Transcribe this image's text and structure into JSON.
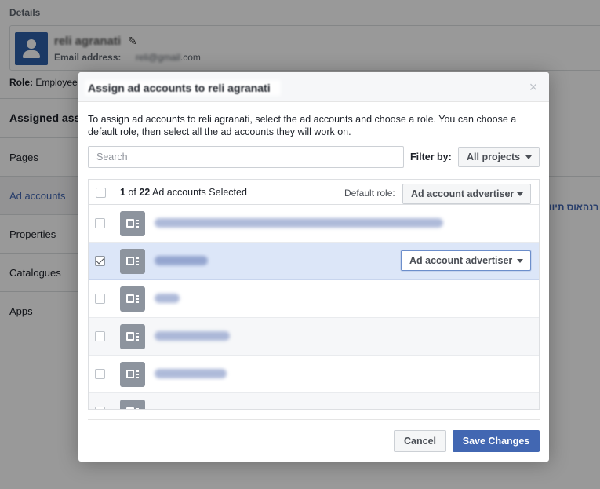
{
  "background": {
    "details_label": "Details",
    "user_name": "reli agranati",
    "email_label": "Email address:",
    "email_blur": "reli@gmail",
    "email_domain": ".com",
    "role_label": "Role:",
    "role_value": "Employee",
    "assigned_heading": "Assigned ass",
    "nav": [
      "Pages",
      "Ad accounts",
      "Properties",
      "Catalogues",
      "Apps"
    ],
    "active_nav": "Ad accounts",
    "hebrew_link": "רנהאוס תיוו"
  },
  "modal": {
    "title": "Assign ad accounts to reli agranati",
    "close_glyph": "×",
    "description": "To assign ad accounts to reli agranati, select the ad accounts and choose a role. You can choose a default role, then select all the ad accounts they will work on.",
    "search_placeholder": "Search",
    "filter_label": "Filter by:",
    "filter_value": "All projects",
    "selected_count": "1",
    "selected_of": " of ",
    "total_count": "22",
    "selected_suffix": " Ad accounts Selected",
    "default_role_label": "Default role:",
    "default_role_value": "Ad account advertiser",
    "rows": [
      {
        "checked": false,
        "role": null
      },
      {
        "checked": true,
        "role": "Ad account advertiser"
      },
      {
        "checked": false,
        "role": null
      },
      {
        "checked": false,
        "role": null
      },
      {
        "checked": false,
        "role": null
      },
      {
        "checked": false,
        "role": null
      }
    ],
    "cancel_label": "Cancel",
    "save_label": "Save Changes"
  },
  "colors": {
    "brand_blue": "#4267b2",
    "selected_row": "#dce6f8",
    "icon_gray": "#8d949e"
  }
}
